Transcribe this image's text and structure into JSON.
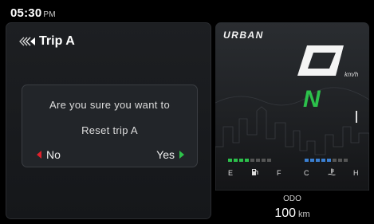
{
  "clock": {
    "time": "05:30",
    "ampm": "PM"
  },
  "trip": {
    "title": "Trip A"
  },
  "dialog": {
    "line1": "Are you sure you want to",
    "line2": "Reset trip A",
    "no_label": "No",
    "yes_label": "Yes"
  },
  "cluster": {
    "mode": "URBAN",
    "speed_unit": "km/h",
    "gear": "N",
    "fuel_empty_label": "E",
    "fuel_full_label": "F",
    "temp_cold_label": "C",
    "temp_hot_label": "H"
  },
  "odo": {
    "label": "ODO",
    "value": "100",
    "unit": "km"
  },
  "colors": {
    "accent_green": "#2cc04b",
    "accent_red": "#e0212b",
    "temp_blue": "#3b7fd1"
  },
  "icons": {
    "back": "triple-chevron-left-icon",
    "fuel": "fuel-pump-icon",
    "temp": "coolant-temp-icon"
  }
}
